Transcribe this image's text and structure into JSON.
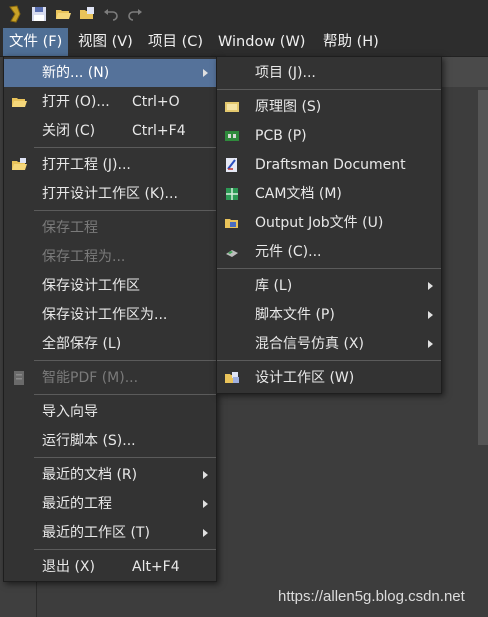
{
  "menubar": {
    "file": "文件 (F)",
    "view": "视图 (V)",
    "project": "项目 (C)",
    "window": "Window (W)",
    "help": "帮助 (H)"
  },
  "file_menu": {
    "new": "新的... (N)",
    "open": "打开 (O)...",
    "open_shortcut": "Ctrl+O",
    "close": "关闭 (C)",
    "close_shortcut": "Ctrl+F4",
    "open_project": "打开工程 (J)...",
    "open_workspace": "打开设计工作区 (K)...",
    "save_project": "保存工程",
    "save_project_as": "保存工程为...",
    "save_workspace": "保存设计工作区",
    "save_workspace_as": "保存设计工作区为...",
    "save_all": "全部保存 (L)",
    "smart_pdf": "智能PDF (M)...",
    "import_wizard": "导入向导",
    "run_script": "运行脚本 (S)...",
    "recent_documents": "最近的文档 (R)",
    "recent_projects": "最近的工程",
    "recent_workspaces": "最近的工作区 (T)",
    "exit": "退出 (X)",
    "exit_shortcut": "Alt+F4"
  },
  "new_menu": {
    "project": "项目 (J)...",
    "schematic": "原理图 (S)",
    "pcb": "PCB (P)",
    "draftsman": "Draftsman Document",
    "cam": "CAM文档 (M)",
    "output_job": "Output Job文件 (U)",
    "component": "元件 (C)...",
    "library": "库 (L)",
    "script_file": "脚本文件 (P)",
    "mixed_signal": "混合信号仿真 (X)",
    "design_workspace": "设计工作区 (W)"
  },
  "watermark": "https://allen5g.blog.csdn.net",
  "colors": {
    "menubar_bg": "#2d2d2d",
    "menu_bg": "#333333",
    "highlight": "#55729a",
    "disabled_text": "#7a7a7a"
  }
}
